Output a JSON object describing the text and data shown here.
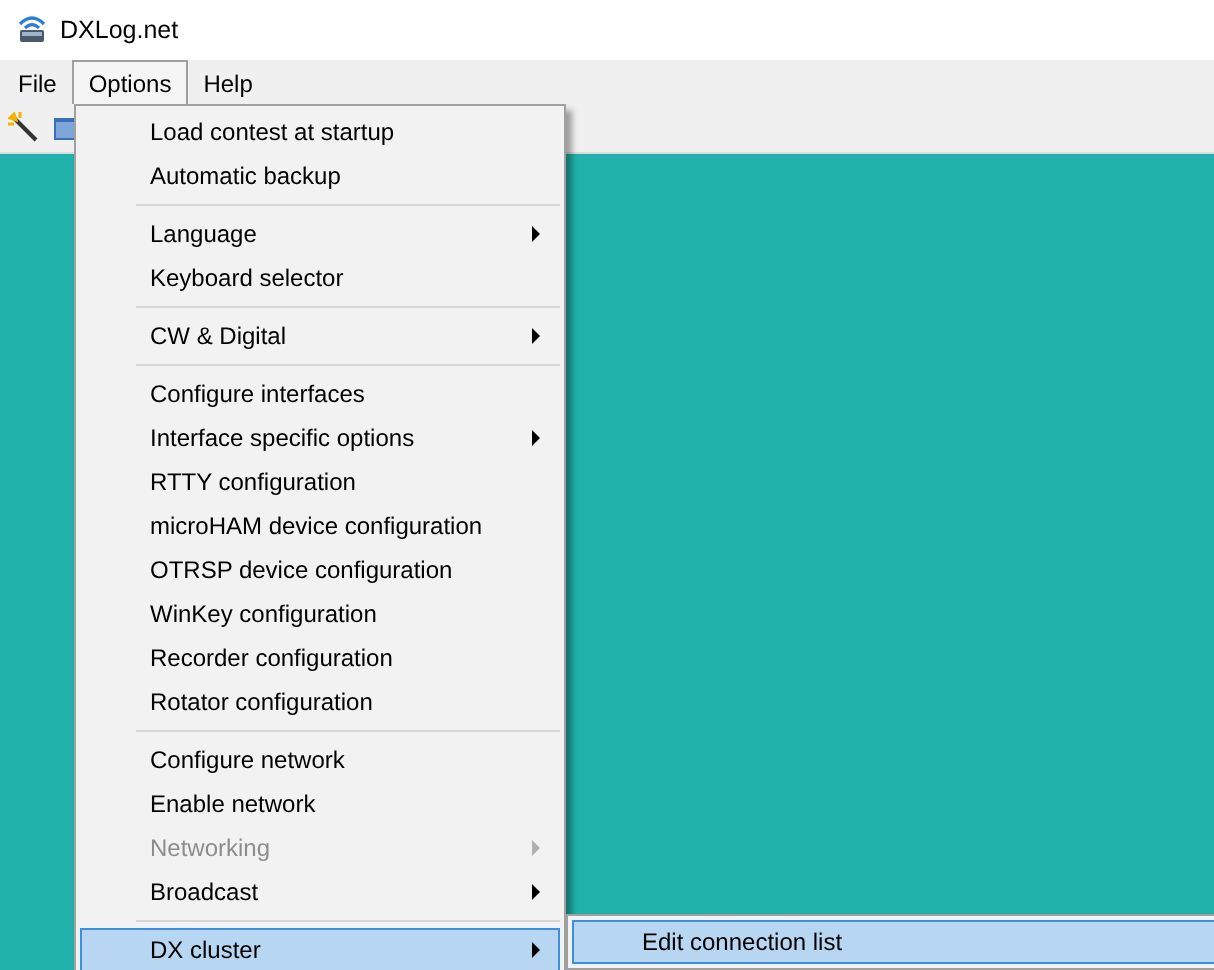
{
  "window": {
    "title": "DXLog.net"
  },
  "menubar": [
    {
      "label": "File",
      "selected": false
    },
    {
      "label": "Options",
      "selected": true
    },
    {
      "label": "Help",
      "selected": false
    }
  ],
  "options_menu": [
    {
      "kind": "item",
      "label": "Load contest at startup",
      "submenu": false,
      "disabled": false,
      "selected": false
    },
    {
      "kind": "item",
      "label": "Automatic backup",
      "submenu": false,
      "disabled": false,
      "selected": false
    },
    {
      "kind": "separator"
    },
    {
      "kind": "item",
      "label": "Language",
      "submenu": true,
      "disabled": false,
      "selected": false
    },
    {
      "kind": "item",
      "label": "Keyboard selector",
      "submenu": false,
      "disabled": false,
      "selected": false
    },
    {
      "kind": "separator"
    },
    {
      "kind": "item",
      "label": "CW & Digital",
      "submenu": true,
      "disabled": false,
      "selected": false
    },
    {
      "kind": "separator"
    },
    {
      "kind": "item",
      "label": "Configure interfaces",
      "submenu": false,
      "disabled": false,
      "selected": false
    },
    {
      "kind": "item",
      "label": "Interface specific options",
      "submenu": true,
      "disabled": false,
      "selected": false
    },
    {
      "kind": "item",
      "label": "RTTY configuration",
      "submenu": false,
      "disabled": false,
      "selected": false
    },
    {
      "kind": "item",
      "label": "microHAM device configuration",
      "submenu": false,
      "disabled": false,
      "selected": false
    },
    {
      "kind": "item",
      "label": "OTRSP device configuration",
      "submenu": false,
      "disabled": false,
      "selected": false
    },
    {
      "kind": "item",
      "label": "WinKey configuration",
      "submenu": false,
      "disabled": false,
      "selected": false
    },
    {
      "kind": "item",
      "label": "Recorder configuration",
      "submenu": false,
      "disabled": false,
      "selected": false
    },
    {
      "kind": "item",
      "label": "Rotator configuration",
      "submenu": false,
      "disabled": false,
      "selected": false
    },
    {
      "kind": "separator"
    },
    {
      "kind": "item",
      "label": "Configure network",
      "submenu": false,
      "disabled": false,
      "selected": false
    },
    {
      "kind": "item",
      "label": "Enable network",
      "submenu": false,
      "disabled": false,
      "selected": false
    },
    {
      "kind": "item",
      "label": "Networking",
      "submenu": true,
      "disabled": true,
      "selected": false
    },
    {
      "kind": "item",
      "label": "Broadcast",
      "submenu": true,
      "disabled": false,
      "selected": false
    },
    {
      "kind": "separator"
    },
    {
      "kind": "item",
      "label": "DX cluster",
      "submenu": true,
      "disabled": false,
      "selected": true
    }
  ],
  "dx_cluster_submenu": [
    {
      "label": "Edit connection list",
      "selected": true
    }
  ]
}
